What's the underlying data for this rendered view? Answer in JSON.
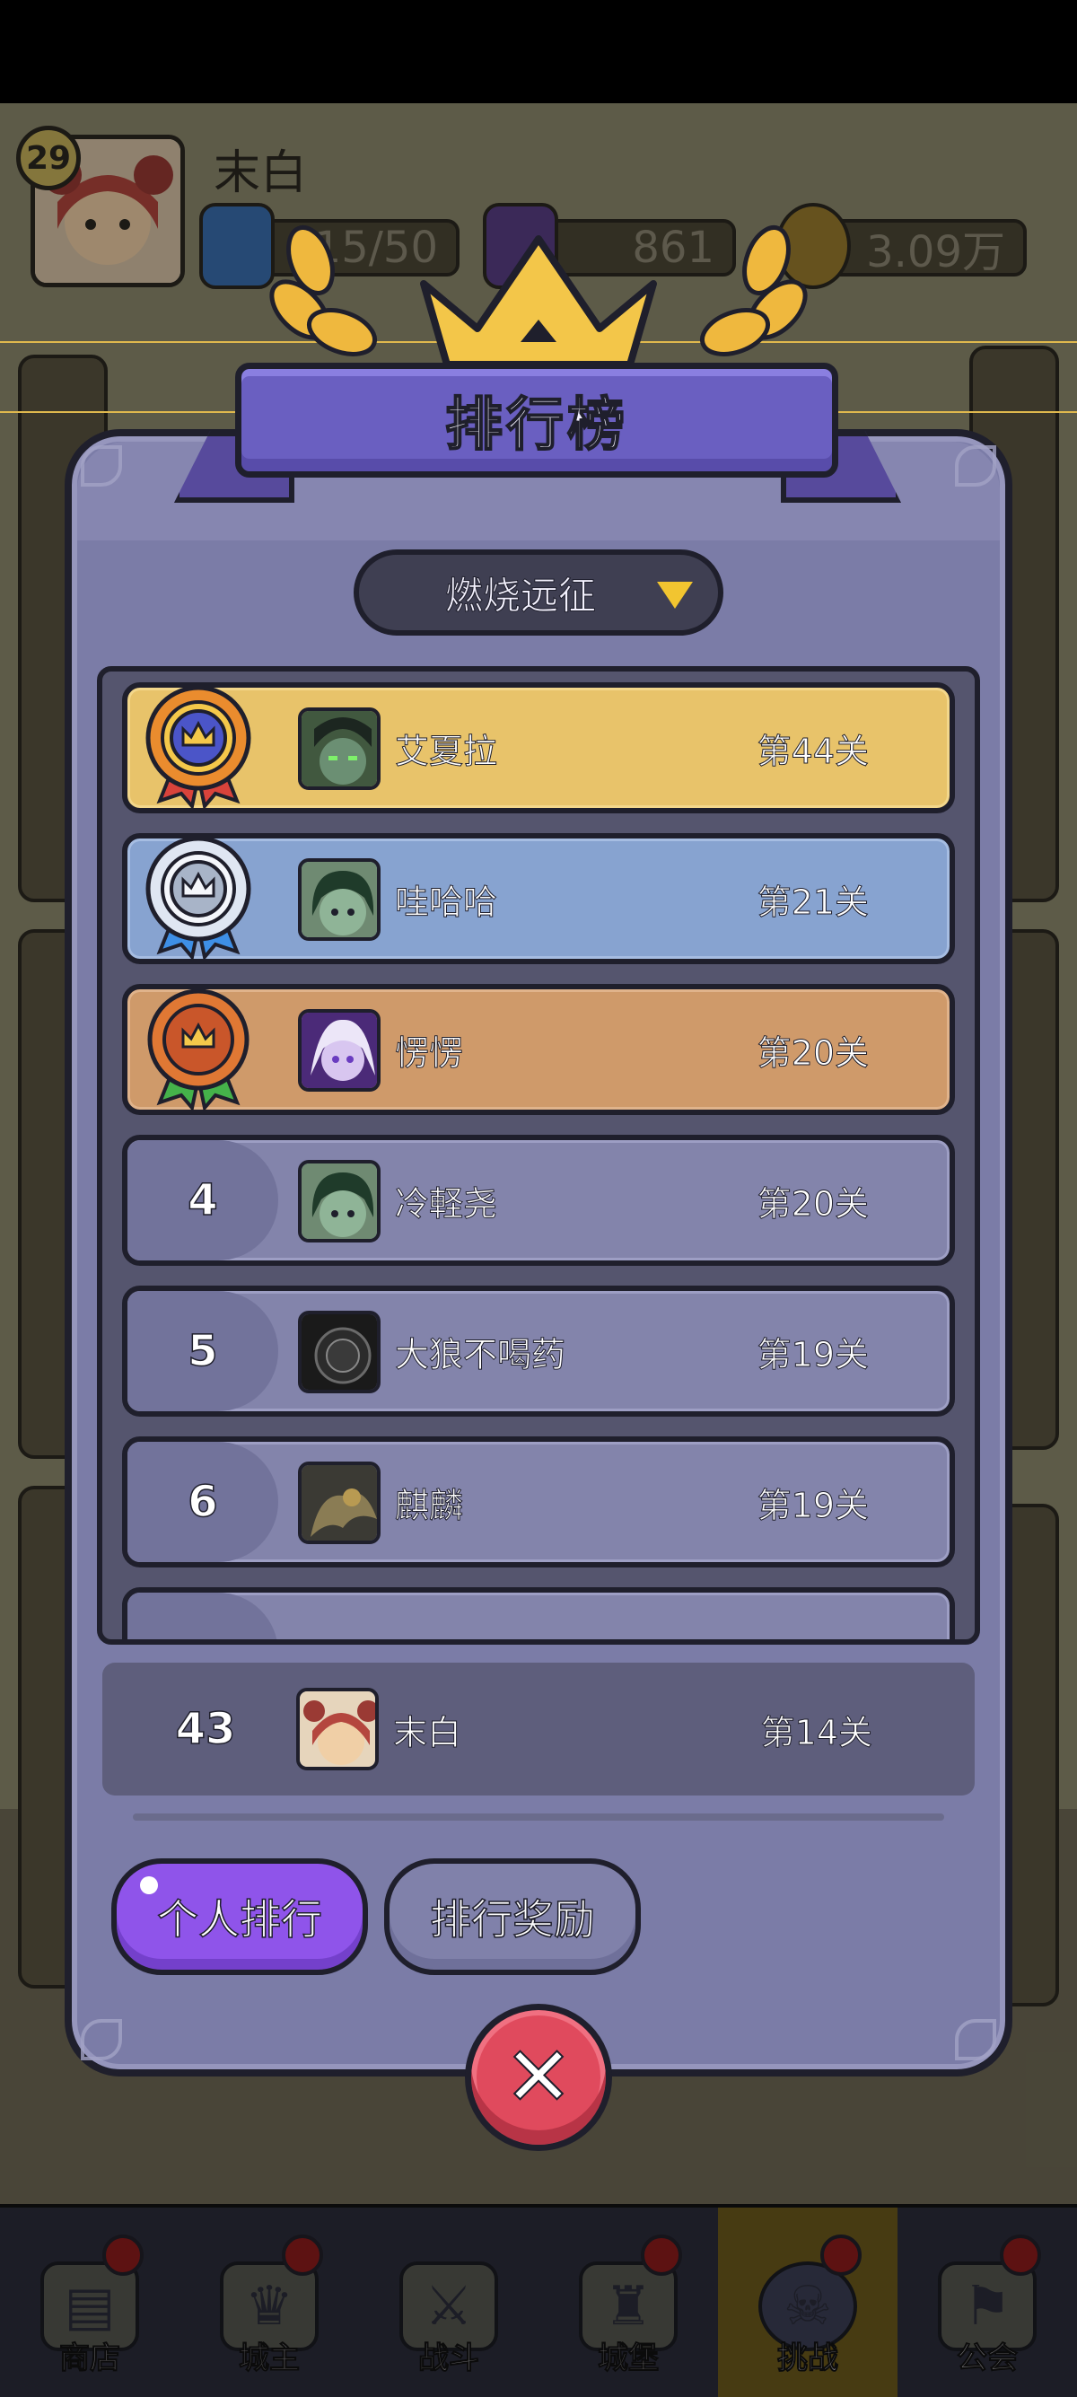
{
  "hud": {
    "player_level": "29",
    "player_name": "末白",
    "energy": "15/50",
    "gems": "861",
    "gold": "3.09万"
  },
  "modal": {
    "title": "排行榜",
    "mode_selected": "燃烧远征",
    "rankings": [
      {
        "rank": "1",
        "name": "艾夏拉",
        "stage": "第44关",
        "tier": "gold"
      },
      {
        "rank": "2",
        "name": "哇哈哈",
        "stage": "第21关",
        "tier": "silver"
      },
      {
        "rank": "3",
        "name": "愣愣",
        "stage": "第20关",
        "tier": "bronze"
      },
      {
        "rank": "4",
        "name": "冷軽尧",
        "stage": "第20关",
        "tier": "normal"
      },
      {
        "rank": "5",
        "name": "大狼不喝药",
        "stage": "第19关",
        "tier": "normal"
      },
      {
        "rank": "6",
        "name": "麒麟",
        "stage": "第19关",
        "tier": "normal"
      }
    ],
    "self": {
      "rank": "43",
      "name": "末白",
      "stage": "第14关"
    },
    "tabs": {
      "personal": "个人排行",
      "rewards": "排行奖励"
    }
  },
  "bottom_nav": [
    {
      "label": "商店",
      "icon": "shop-icon"
    },
    {
      "label": "城主",
      "icon": "crown-icon"
    },
    {
      "label": "战斗",
      "icon": "crossed-swords-icon"
    },
    {
      "label": "城堡",
      "icon": "castle-icon"
    },
    {
      "label": "挑战",
      "icon": "demon-helmet-icon",
      "active": true
    },
    {
      "label": "公会",
      "icon": "guild-banner-icon"
    }
  ],
  "colors": {
    "modal_bg": "#7b7ca7",
    "banner": "#6a5fc1",
    "gold_row": "#e8c36a",
    "silver_row": "#87a3d0",
    "bronze_row": "#cf9a6a",
    "active_tab": "#8f54ea",
    "close_button": "#e04a5d"
  }
}
